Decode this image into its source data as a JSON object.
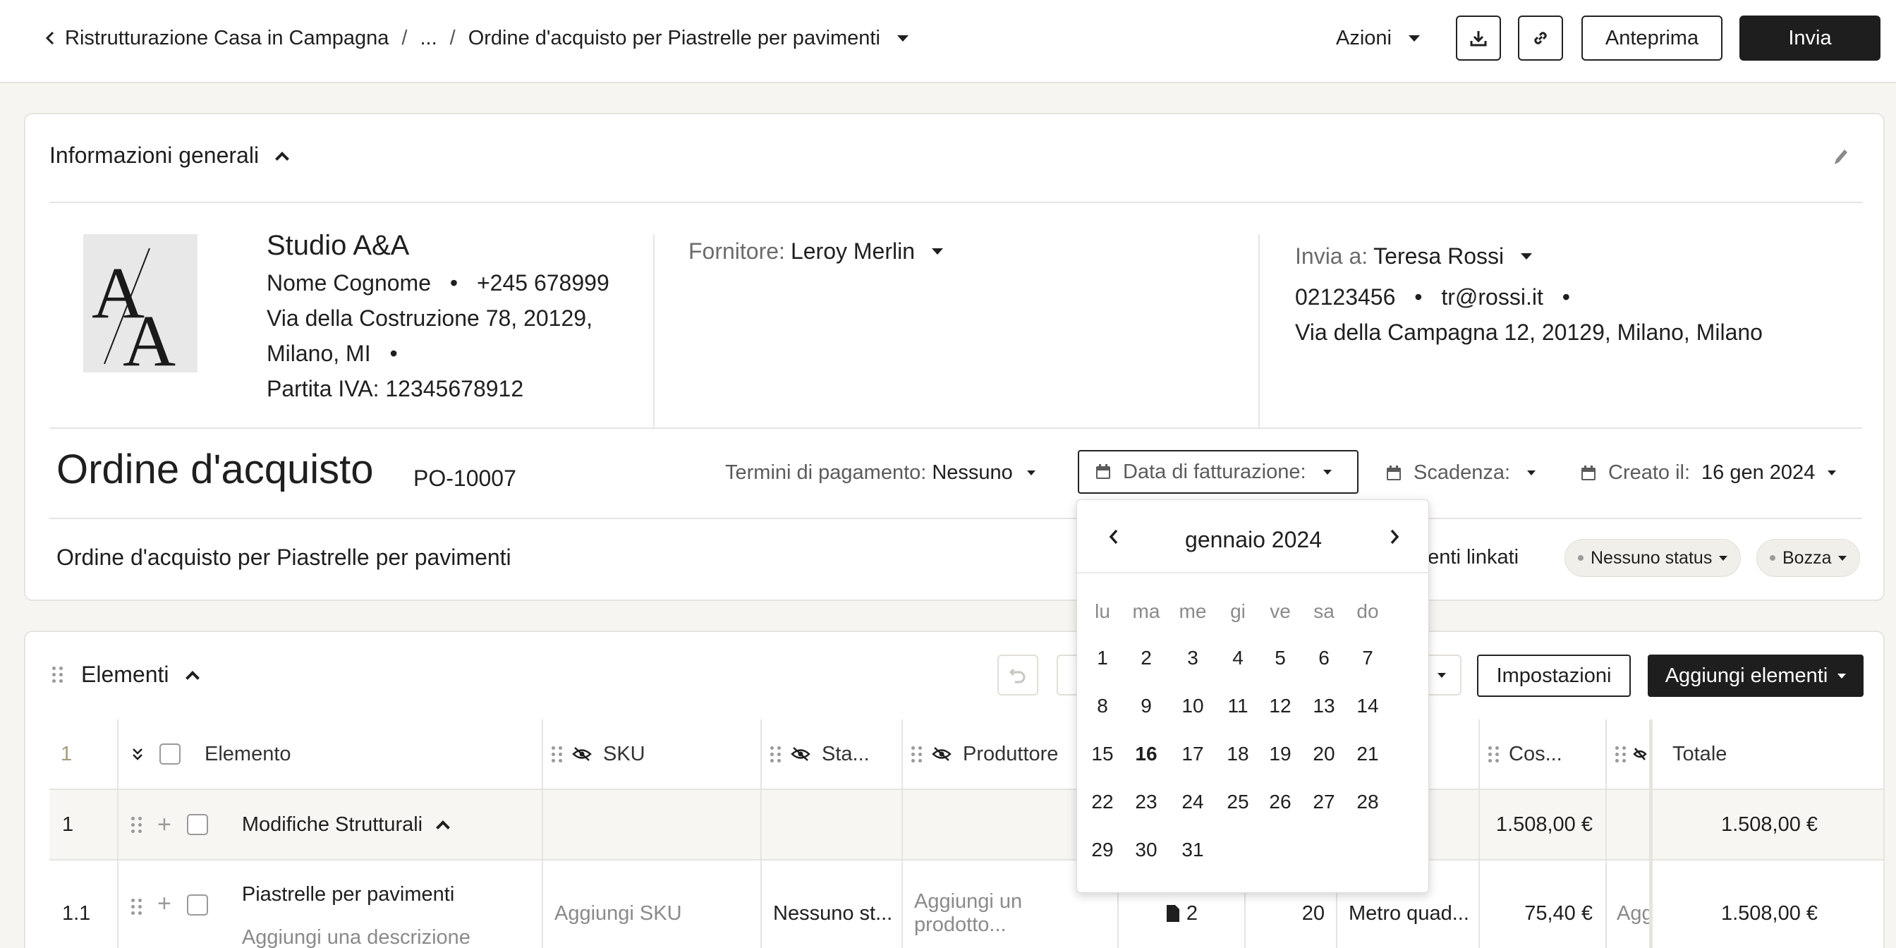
{
  "topbar": {
    "breadcrumb": [
      "Ristrutturazione Casa in Campagna",
      "...",
      "Ordine d'acquisto per Piastrelle per pavimenti"
    ],
    "separator": "/",
    "actions_label": "Azioni",
    "preview_label": "Anteprima",
    "send_label": "Invia"
  },
  "general": {
    "section_title": "Informazioni generali",
    "company": {
      "name": "Studio A&A",
      "contact_name": "Nome Cognome",
      "phone": "+245 678999",
      "address_line1": "Via della Costruzione 78, 20129,",
      "address_line2": "Milano, MI",
      "vat": "Partita IVA: 12345678912",
      "logo_text": "A/A"
    },
    "supplier": {
      "label": "Fornitore:",
      "value": "Leroy Merlin"
    },
    "ship_to": {
      "label": "Invia a:",
      "name": "Teresa Rossi",
      "phone": "02123456",
      "email": "tr@rossi.it",
      "address": "Via della Campagna 12, 20129, Milano, Milano"
    },
    "bullet": "•"
  },
  "order": {
    "title": "Ordine d'acquisto",
    "number": "PO-10007",
    "payment_terms_label": "Termini di pagamento:",
    "payment_terms_value": "Nessuno",
    "invoice_date_label": "Data di fatturazione:",
    "due_label": "Scadenza:",
    "created_label": "Creato il:",
    "created_value": "16 gen 2024",
    "subtitle": "Ordine d'acquisto per Piastrelle per pavimenti",
    "linked_label": "menti linkati",
    "status_pill": "Nessuno status",
    "draft_pill": "Bozza"
  },
  "calendar": {
    "month_label": "gennaio 2024",
    "weekdays": [
      "lu",
      "ma",
      "me",
      "gi",
      "ve",
      "sa",
      "do"
    ],
    "weeks": [
      [
        "1",
        "2",
        "3",
        "4",
        "5",
        "6",
        "7"
      ],
      [
        "8",
        "9",
        "10",
        "11",
        "12",
        "13",
        "14"
      ],
      [
        "15",
        "16",
        "17",
        "18",
        "19",
        "20",
        "21"
      ],
      [
        "22",
        "23",
        "24",
        "25",
        "26",
        "27",
        "28"
      ],
      [
        "29",
        "30",
        "31"
      ]
    ],
    "highlighted_day": "16"
  },
  "items": {
    "section_title": "Elementi",
    "settings_label": "Impostazioni",
    "add_label": "Aggiungi elementi",
    "headers": {
      "index": "1",
      "element": "Elemento",
      "sku": "SKU",
      "status": "Sta...",
      "producer": "Produttore",
      "cost": "Cos...",
      "total": "Totale"
    },
    "group": {
      "index": "1",
      "name": "Modifiche Strutturali",
      "cost": "1.508,00 €",
      "total": "1.508,00 €"
    },
    "row": {
      "index": "1.1",
      "name": "Piastrelle per pavimenti",
      "description_placeholder": "Aggiungi una descrizione",
      "sku_placeholder": "Aggiungi SKU",
      "status": "Nessuno st...",
      "producer_placeholder": "Aggiungi un prodotto...",
      "files": "2",
      "quantity": "20",
      "unit": "Metro quad...",
      "cost": "75,40 €",
      "extra": "Agg",
      "total": "1.508,00 €"
    }
  },
  "colors": {
    "dark": "#1e1e1e",
    "border": "#e6e4df",
    "muted": "#8a8a8a",
    "group_bg": "#f7f6f3"
  }
}
